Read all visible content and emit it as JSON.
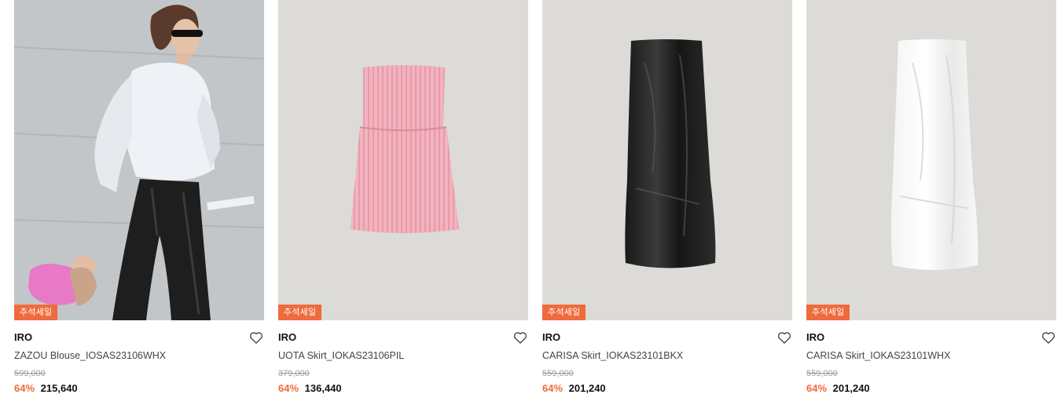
{
  "products": [
    {
      "brand": "IRO",
      "name": "ZAZOU Blouse_IOSAS23106WHX",
      "badge": "추석세일",
      "original_price": "599,000",
      "discount": "64%",
      "sale_price": "215,640",
      "image": "model-blouse-photo"
    },
    {
      "brand": "IRO",
      "name": "UOTA Skirt_IOKAS23106PIL",
      "badge": "추석세일",
      "original_price": "379,000",
      "discount": "64%",
      "sale_price": "136,440",
      "image": "pink-knit-skirt"
    },
    {
      "brand": "IRO",
      "name": "CARISA Skirt_IOKAS23101BKX",
      "badge": "추석세일",
      "original_price": "559,000",
      "discount": "64%",
      "sale_price": "201,240",
      "image": "black-satin-skirt"
    },
    {
      "brand": "IRO",
      "name": "CARISA Skirt_IOKAS23101WHX",
      "badge": "추석세일",
      "original_price": "559,000",
      "discount": "64%",
      "sale_price": "201,240",
      "image": "white-satin-skirt"
    }
  ],
  "icons": {
    "wishlist": "heart-outline-icon"
  },
  "colors": {
    "badge": "#ef6a3c",
    "discount": "#ef6a3c",
    "image_bg": "#dcdbd7"
  }
}
